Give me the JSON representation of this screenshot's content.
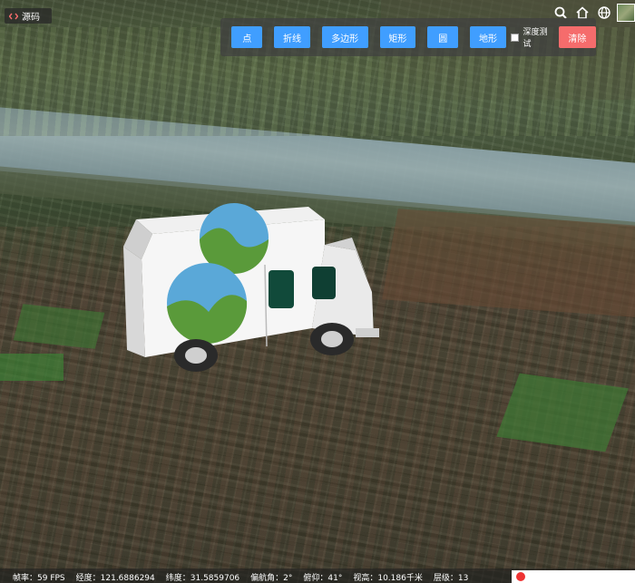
{
  "source_button": {
    "label": "源码",
    "icon": "code-icon"
  },
  "toolbar": {
    "point": "点",
    "polyline": "折线",
    "polygon": "多边形",
    "rectangle": "矩形",
    "circle": "圆",
    "terrain": "地形",
    "depth_test": "深度测试",
    "depth_test_checked": false,
    "clear": "清除",
    "primary_color": "#409eff",
    "danger_color": "#f56c6c"
  },
  "nav": {
    "icons": [
      "search-icon",
      "home-icon",
      "globe-icon",
      "layers-icon"
    ]
  },
  "status": {
    "fps": "帧率：59 FPS",
    "lon": "经度：121.6886294",
    "lat": "纬度：31.5859706",
    "heading": "偏航角：2°",
    "pitch": "俯仰：41°",
    "height": "视高：10.186千米",
    "zoom": "层级：13"
  }
}
